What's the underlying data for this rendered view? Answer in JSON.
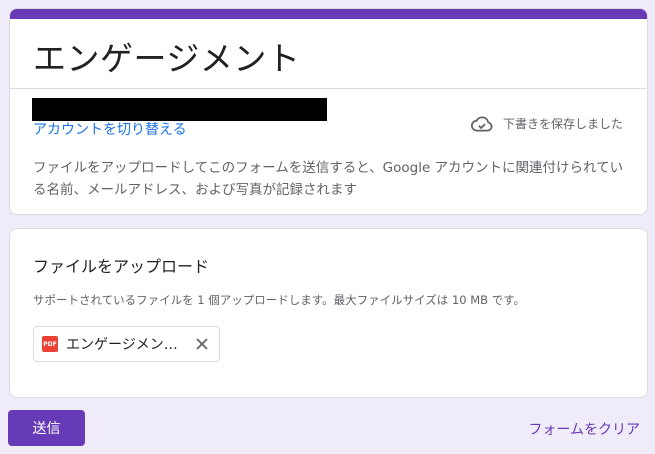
{
  "form": {
    "title": "エンゲージメント",
    "switch_account_label": "アカウントを切り替える",
    "draft_status": "下書きを保存しました",
    "notice": "ファイルをアップロードしてこのフォームを送信すると、Google アカウントに関連付けられている名前、メールアドレス、および写真が記録されます"
  },
  "question": {
    "title": "ファイルをアップロード",
    "description": "サポートされているファイルを 1 個アップロードします。最大ファイルサイズは 10 MB です。",
    "file": {
      "name": "エンゲージメント.pdf",
      "type_badge": "PDF",
      "icon": "pdf-file-icon"
    }
  },
  "actions": {
    "submit_label": "送信",
    "clear_label": "フォームをクリア"
  },
  "colors": {
    "accent": "#673ab7",
    "background": "#f0ebf8",
    "link": "#1a73e8",
    "pdf": "#ea4335"
  },
  "icons": {
    "draft": "cloud-done-icon",
    "remove": "close-icon"
  }
}
